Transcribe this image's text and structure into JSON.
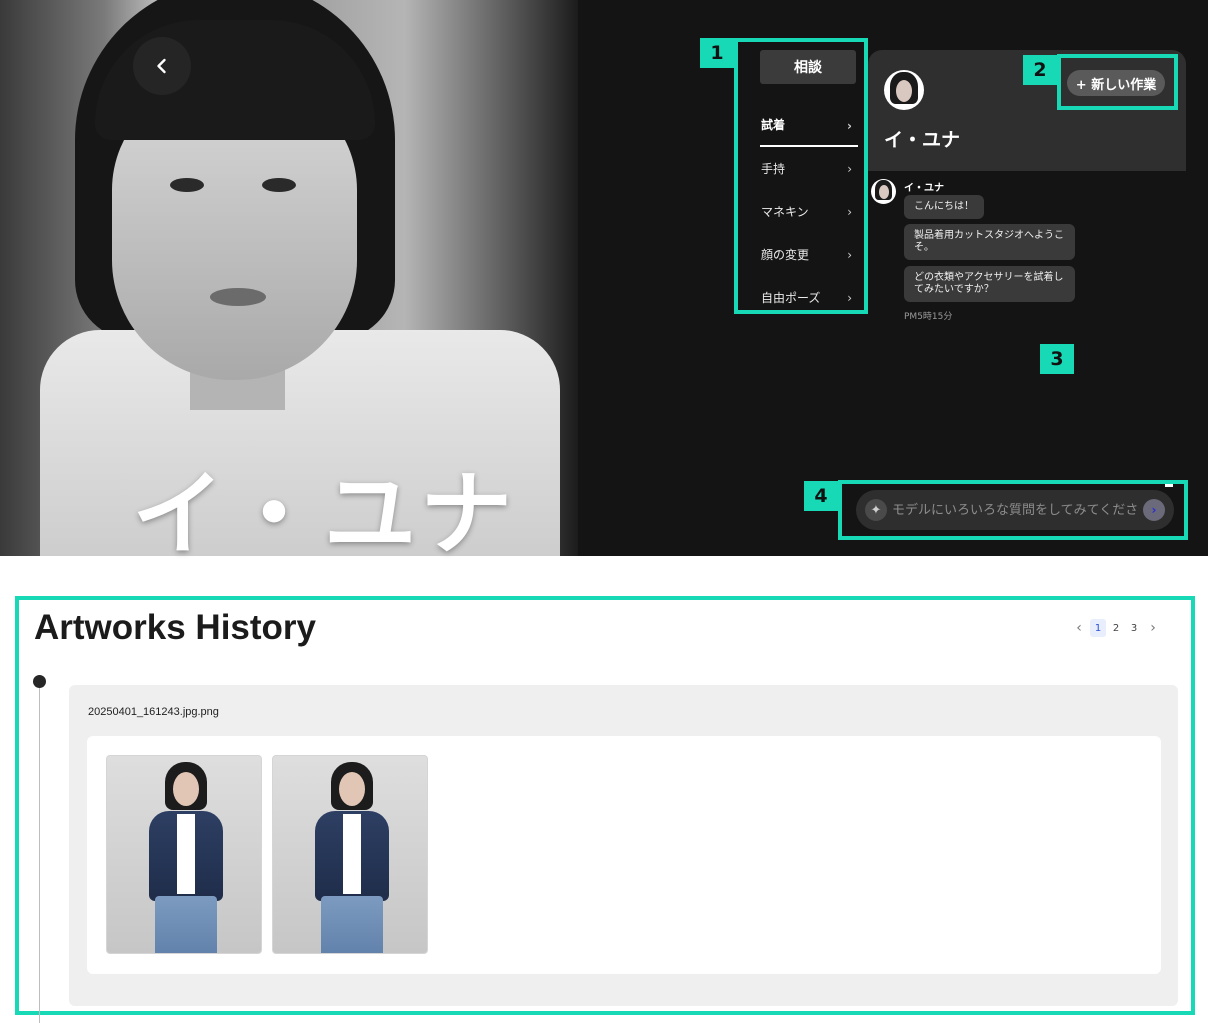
{
  "hero": {
    "name": "イ・ユナ"
  },
  "menu": {
    "top_label": "相談",
    "items": [
      {
        "label": "試着",
        "active": true
      },
      {
        "label": "手持",
        "active": false
      },
      {
        "label": "マネキン",
        "active": false
      },
      {
        "label": "顔の変更",
        "active": false
      },
      {
        "label": "自由ポーズ",
        "active": false
      }
    ]
  },
  "chat": {
    "name": "イ・ユナ",
    "new_task_label": "+ 新しい作業",
    "sender": "イ・ユナ",
    "messages": [
      "こんにちは！",
      "製品着用カットスタジオへようこそ。",
      "どの衣類やアクセサリーを試着してみたいですか？"
    ],
    "time": "PM5時15分",
    "input_placeholder": "モデルにいろいろな質問をしてみてください",
    "input_value": ""
  },
  "annotations": [
    "1",
    "2",
    "3",
    "4"
  ],
  "history": {
    "title": "Artworks History",
    "pages": [
      "1",
      "2",
      "3"
    ],
    "current_page": "1",
    "entries": [
      {
        "file_name": "20250401_161243.jpg.png",
        "thumbnails": 2
      }
    ]
  },
  "colors": {
    "annotation": "#17d9b6",
    "dark_panel": "#141414",
    "chat_header": "#2f2f2f"
  }
}
